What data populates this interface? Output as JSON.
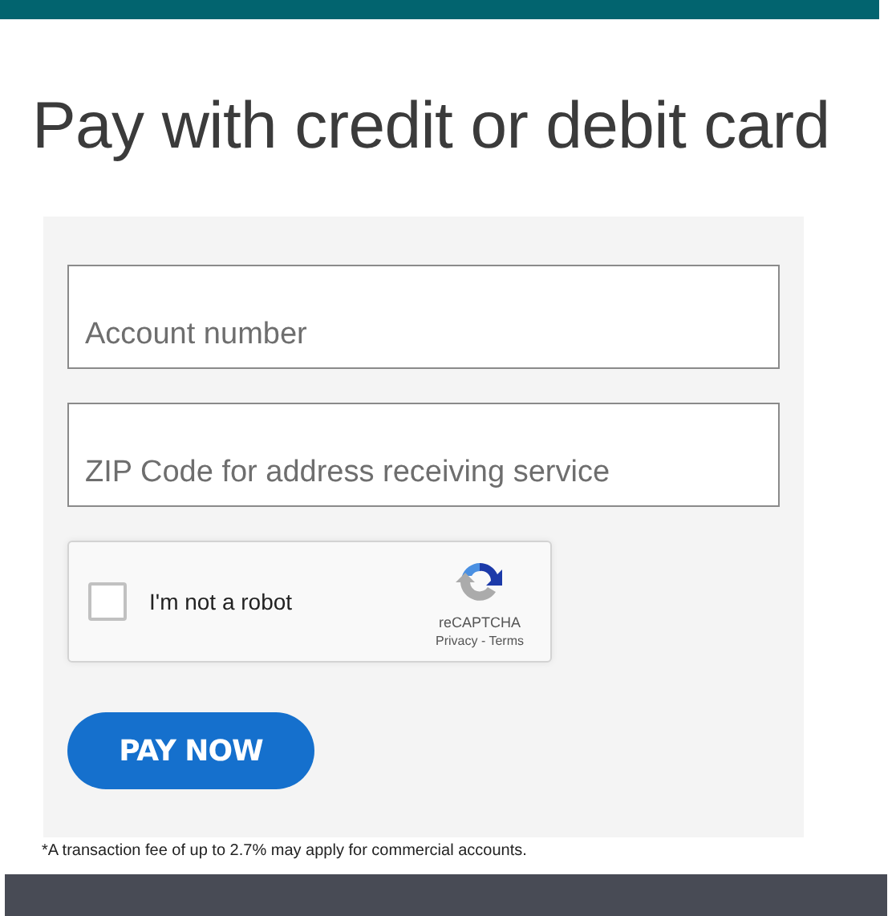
{
  "title": "Pay with credit or debit card",
  "fields": [
    {
      "placeholder": "Account number"
    },
    {
      "placeholder": "ZIP Code for address receiving service"
    }
  ],
  "captcha": {
    "label": "I'm not a robot",
    "checked": false,
    "brand": "reCAPTCHA",
    "links": [
      "Privacy",
      "Terms"
    ],
    "separator": " - "
  },
  "button": "PAY NOW",
  "footnote": "*A transaction fee of up to 2.7% may apply for commercial accounts."
}
